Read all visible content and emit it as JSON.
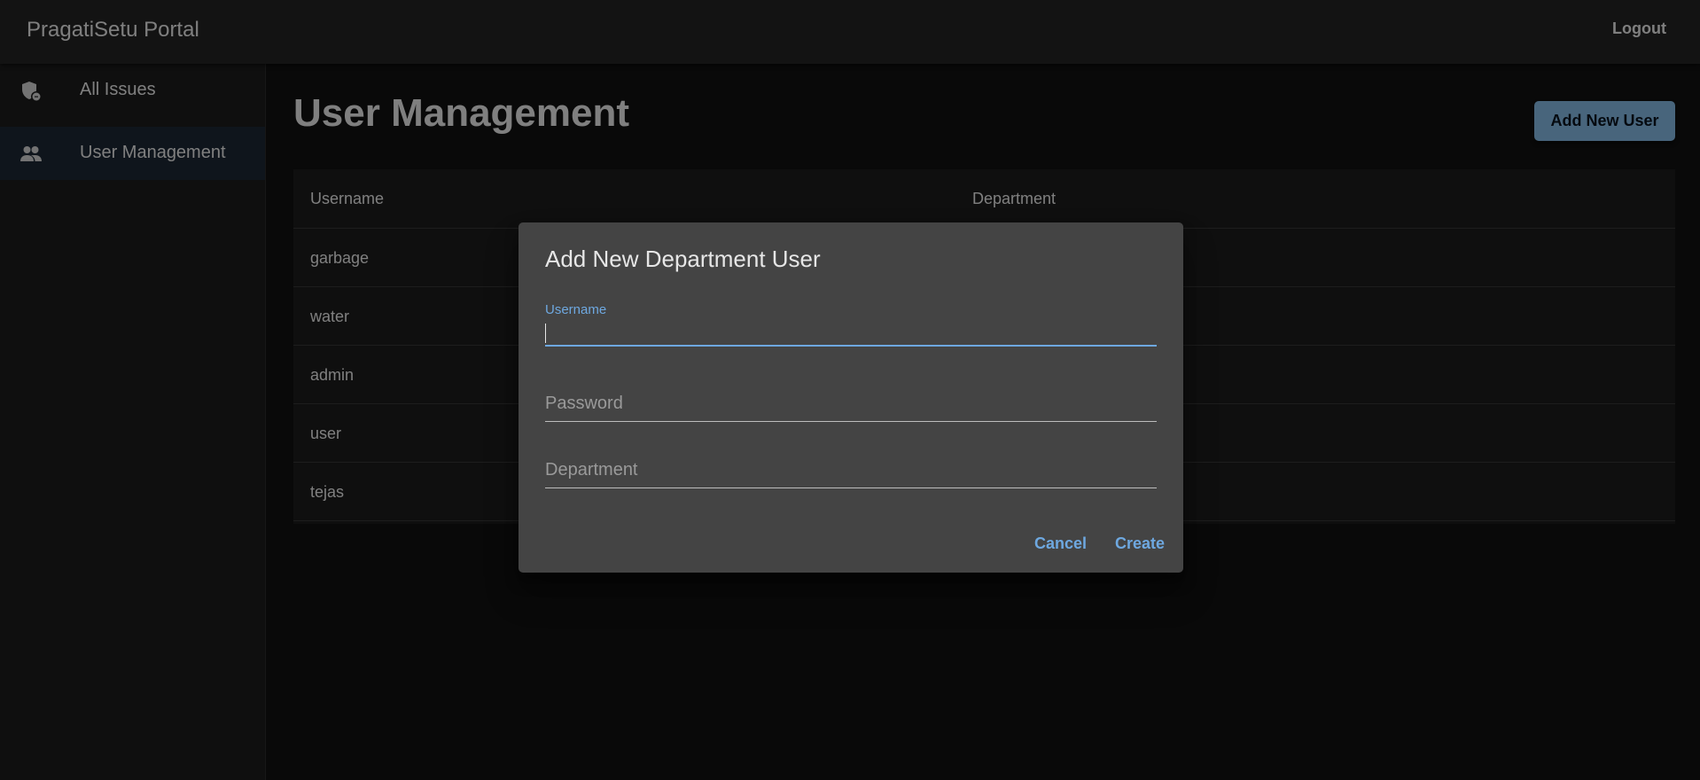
{
  "app": {
    "title": "PragatiSetu Portal",
    "logout_label": "Logout"
  },
  "sidebar": {
    "items": [
      {
        "label": "All Issues",
        "icon": "shield-icon"
      },
      {
        "label": "User Management",
        "icon": "people-icon"
      }
    ]
  },
  "main": {
    "title": "User Management",
    "add_button": "Add New User",
    "table": {
      "headers": [
        "Username",
        "Department"
      ],
      "rows": [
        {
          "username": "garbage"
        },
        {
          "username": "water"
        },
        {
          "username": "admin"
        },
        {
          "username": "user"
        },
        {
          "username": "tejas"
        }
      ]
    }
  },
  "dialog": {
    "title": "Add New Department User",
    "fields": {
      "username": {
        "label": "Username",
        "value": ""
      },
      "password": {
        "placeholder": "Password"
      },
      "department": {
        "placeholder": "Department"
      }
    },
    "cancel_label": "Cancel",
    "create_label": "Create"
  },
  "colors": {
    "primary": "#90caf9",
    "accent_text": "#6ea8e0",
    "selected_nav": "#1e2a38"
  }
}
